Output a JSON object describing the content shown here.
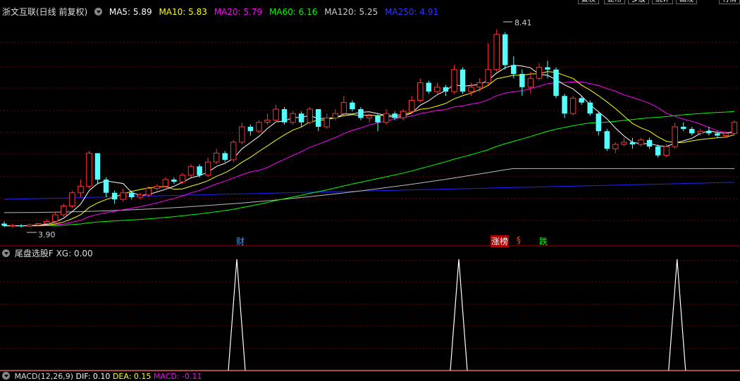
{
  "toolbar": {
    "right_buttons": [
      "复权",
      "正常",
      "多股",
      "统计",
      "画线",
      "行情"
    ]
  },
  "main_header": {
    "title": "浙文互联(日线 前复权)",
    "mas": [
      {
        "label": "MA5: 5.89",
        "color": "#ffffff"
      },
      {
        "label": "MA10: 5.83",
        "color": "#ffff00"
      },
      {
        "label": "MA20: 5.79",
        "color": "#ff00ff"
      },
      {
        "label": "MA60: 6.16",
        "color": "#00ff00"
      },
      {
        "label": "MA120: 5.25",
        "color": "#cccccc"
      },
      {
        "label": "MA250: 4.91",
        "color": "#3333ff"
      }
    ]
  },
  "price_labels": {
    "high": "8.41",
    "low": "3.90"
  },
  "event_tags": {
    "cai": "财",
    "zhangbang": "涨榜",
    "s_mark": "§",
    "die": "跌"
  },
  "sub_header": {
    "title": "尾盘选股F",
    "value_label": "XG: 0.00"
  },
  "bottom_header": {
    "title": "MACD(12,26,9)",
    "dif": "DIF: 0.10",
    "dea": "DEA: 0.15",
    "macd": "MACD: -0.11"
  },
  "chart_data": {
    "type": "candlestick",
    "colors": {
      "up": "#ff3232",
      "down": "#54ffff",
      "ma5": "#ffffff",
      "ma10": "#ffff00",
      "ma20": "#ff00ff",
      "ma60": "#00ff00",
      "ma120": "#bbbbbb",
      "ma250": "#2222ff"
    },
    "price_range": [
      3.8,
      8.6
    ],
    "candles": [
      [
        4.0,
        3.95,
        4.05,
        3.92
      ],
      [
        3.95,
        3.96,
        4.0,
        3.9
      ],
      [
        3.96,
        3.94,
        3.99,
        3.91
      ],
      [
        3.94,
        3.97,
        4.0,
        3.92
      ],
      [
        3.97,
        4.0,
        4.02,
        3.95
      ],
      [
        4.0,
        4.05,
        4.1,
        3.98
      ],
      [
        4.05,
        4.2,
        4.25,
        4.02
      ],
      [
        4.2,
        4.4,
        4.45,
        4.15
      ],
      [
        4.4,
        4.7,
        4.75,
        4.35
      ],
      [
        4.7,
        4.85,
        5.0,
        4.6
      ],
      [
        4.85,
        5.6,
        5.65,
        4.8
      ],
      [
        5.6,
        5.0,
        5.6,
        4.9
      ],
      [
        5.0,
        4.7,
        5.05,
        4.6
      ],
      [
        4.7,
        4.55,
        4.75,
        4.45
      ],
      [
        4.55,
        4.7,
        4.8,
        4.5
      ],
      [
        4.7,
        4.6,
        4.75,
        4.55
      ],
      [
        4.6,
        4.65,
        4.7,
        4.55
      ],
      [
        4.65,
        4.8,
        4.85,
        4.6
      ],
      [
        4.8,
        4.85,
        4.9,
        4.75
      ],
      [
        4.85,
        5.0,
        5.05,
        4.8
      ],
      [
        5.0,
        4.95,
        5.05,
        4.9
      ],
      [
        4.95,
        5.1,
        5.15,
        4.9
      ],
      [
        5.1,
        5.3,
        5.35,
        5.05
      ],
      [
        5.3,
        5.1,
        5.35,
        5.05
      ],
      [
        5.1,
        5.4,
        5.5,
        5.05
      ],
      [
        5.4,
        5.6,
        5.7,
        5.35
      ],
      [
        5.6,
        5.45,
        5.65,
        5.4
      ],
      [
        5.45,
        5.85,
        5.9,
        5.4
      ],
      [
        5.85,
        6.2,
        6.3,
        5.8
      ],
      [
        6.2,
        6.1,
        6.25,
        6.0
      ],
      [
        6.1,
        6.3,
        6.35,
        6.05
      ],
      [
        6.3,
        6.35,
        6.5,
        6.25
      ],
      [
        6.35,
        6.6,
        6.7,
        6.3
      ],
      [
        6.6,
        6.3,
        6.65,
        6.25
      ],
      [
        6.3,
        6.5,
        6.55,
        6.25
      ],
      [
        6.5,
        6.3,
        6.55,
        6.2
      ],
      [
        6.3,
        6.6,
        6.65,
        6.25
      ],
      [
        6.6,
        6.2,
        6.6,
        6.1
      ],
      [
        6.2,
        6.4,
        6.5,
        6.15
      ],
      [
        6.4,
        6.5,
        6.6,
        6.35
      ],
      [
        6.5,
        6.75,
        6.9,
        6.45
      ],
      [
        6.75,
        6.6,
        6.8,
        6.55
      ],
      [
        6.6,
        6.4,
        6.65,
        6.35
      ],
      [
        6.4,
        6.45,
        6.5,
        6.3
      ],
      [
        6.45,
        6.3,
        6.5,
        6.1
      ],
      [
        6.3,
        6.5,
        6.6,
        6.25
      ],
      [
        6.5,
        6.4,
        6.55,
        6.35
      ],
      [
        6.4,
        6.55,
        6.6,
        6.35
      ],
      [
        6.55,
        6.8,
        6.9,
        6.5
      ],
      [
        6.8,
        7.2,
        7.3,
        6.75
      ],
      [
        7.2,
        7.0,
        7.25,
        6.95
      ],
      [
        7.0,
        7.1,
        7.2,
        6.95
      ],
      [
        7.1,
        7.0,
        7.15,
        6.9
      ],
      [
        7.0,
        7.5,
        7.6,
        6.95
      ],
      [
        7.5,
        7.0,
        7.55,
        6.95
      ],
      [
        7.0,
        7.1,
        7.2,
        6.9
      ],
      [
        7.1,
        7.2,
        7.3,
        7.0
      ],
      [
        7.2,
        7.5,
        8.1,
        7.15
      ],
      [
        7.5,
        8.3,
        8.41,
        7.45
      ],
      [
        8.3,
        7.6,
        8.35,
        7.5
      ],
      [
        7.6,
        7.4,
        7.8,
        7.3
      ],
      [
        7.4,
        7.1,
        7.5,
        6.9
      ],
      [
        7.1,
        7.3,
        7.45,
        6.95
      ],
      [
        7.3,
        7.55,
        7.65,
        7.25
      ],
      [
        7.55,
        7.5,
        7.7,
        7.3
      ],
      [
        7.5,
        6.9,
        7.55,
        6.85
      ],
      [
        6.9,
        6.5,
        6.95,
        6.4
      ],
      [
        6.5,
        6.85,
        6.9,
        6.45
      ],
      [
        6.85,
        6.75,
        6.9,
        6.7
      ],
      [
        6.75,
        6.5,
        6.8,
        6.45
      ],
      [
        6.5,
        6.1,
        6.55,
        6.0
      ],
      [
        6.1,
        5.7,
        6.15,
        5.65
      ],
      [
        5.7,
        5.8,
        5.85,
        5.6
      ],
      [
        5.8,
        5.85,
        5.95,
        5.75
      ],
      [
        5.85,
        5.8,
        5.95,
        5.7
      ],
      [
        5.8,
        5.9,
        5.95,
        5.75
      ],
      [
        5.9,
        5.75,
        5.95,
        5.7
      ],
      [
        5.75,
        5.55,
        5.8,
        5.5
      ],
      [
        5.55,
        5.75,
        5.8,
        5.5
      ],
      [
        5.75,
        6.2,
        6.3,
        5.7
      ],
      [
        6.2,
        6.15,
        6.3,
        6.1
      ],
      [
        6.15,
        6.05,
        6.2,
        6.0
      ],
      [
        6.05,
        6.1,
        6.15,
        6.0
      ],
      [
        6.1,
        6.05,
        6.2,
        6.0
      ],
      [
        6.05,
        6.0,
        6.1,
        5.95
      ],
      [
        6.0,
        6.05,
        6.1,
        5.95
      ],
      [
        6.05,
        6.3,
        6.35,
        6.0
      ]
    ],
    "xg_spikes": [
      0.32,
      0.62,
      0.915
    ]
  }
}
